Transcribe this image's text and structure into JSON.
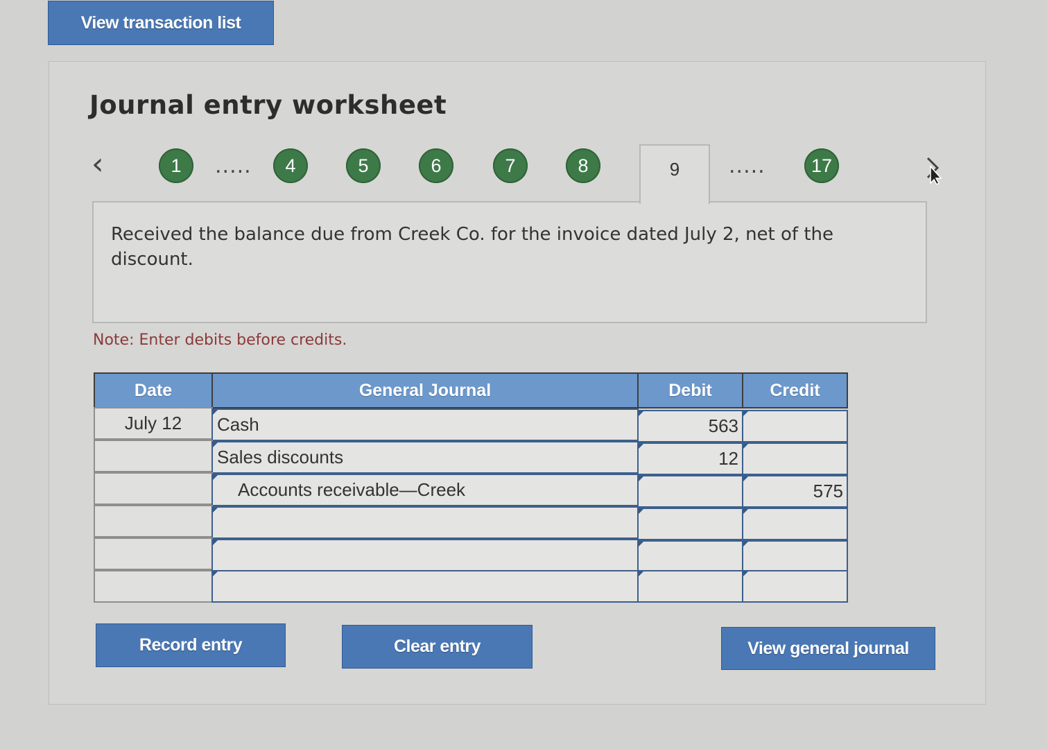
{
  "header": {
    "view_transactions_label": "View transaction list"
  },
  "worksheet": {
    "title": "Journal entry worksheet",
    "steps": [
      "1",
      "4",
      "5",
      "6",
      "7",
      "8",
      "9",
      "17"
    ],
    "active_step": "9",
    "ellipsis": ".....",
    "colors": {
      "step_green": "#3d7a48",
      "button_blue": "#4a78b5",
      "table_header": "#6c98cc",
      "note_red": "#8b3a3a"
    },
    "description": "Received the balance due from Creek Co. for the invoice dated July 2, net of the discount.",
    "note": "Note: Enter debits before credits."
  },
  "journal": {
    "columns": [
      "Date",
      "General Journal",
      "Debit",
      "Credit"
    ],
    "rows": [
      {
        "date": "July 12",
        "account": "Cash",
        "debit": "563",
        "credit": ""
      },
      {
        "date": "",
        "account": "Sales discounts",
        "debit": "12",
        "credit": ""
      },
      {
        "date": "",
        "account": "Accounts receivable—Creek",
        "debit": "",
        "credit": "575"
      },
      {
        "date": "",
        "account": "",
        "debit": "",
        "credit": ""
      },
      {
        "date": "",
        "account": "",
        "debit": "",
        "credit": ""
      },
      {
        "date": "",
        "account": "",
        "debit": "",
        "credit": ""
      }
    ]
  },
  "actions": {
    "record_label": "Record entry",
    "clear_label": "Clear entry",
    "view_journal_label": "View general journal"
  }
}
